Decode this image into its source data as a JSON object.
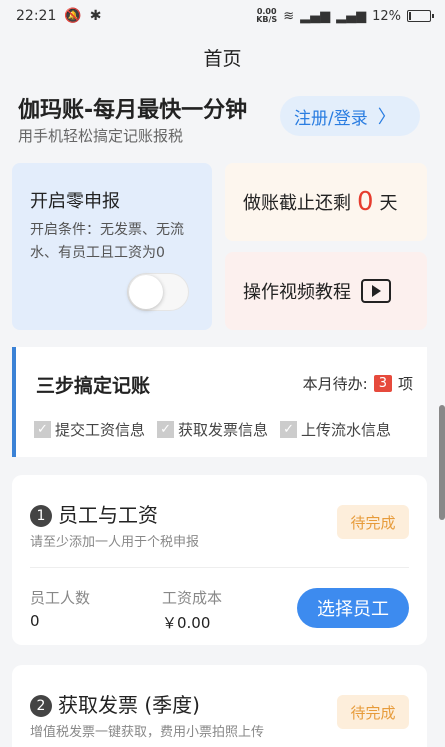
{
  "status": {
    "time": "22:21",
    "net_speed": "0.00",
    "net_unit": "KB/S",
    "battery": "12%",
    "battery_level": 0.12
  },
  "nav": {
    "title": "首页"
  },
  "brand": {
    "title": "伽玛账-每月最快一分钟",
    "subtitle": "用手机轻松搞定记账报税",
    "login_label": "注册/登录"
  },
  "zero_report": {
    "title": "开启零申报",
    "desc": "开启条件：无发票、无流水、有员工且工资为0",
    "toggle_on": false
  },
  "deadline": {
    "prefix": "做账截止还剩",
    "days": "0",
    "suffix": "天"
  },
  "video": {
    "label": "操作视频教程"
  },
  "steps": {
    "title": "三步搞定记账",
    "todo_prefix": "本月待办:",
    "todo_count": "3",
    "todo_suffix": "项",
    "items": [
      "提交工资信息",
      "获取发票信息",
      "上传流水信息"
    ]
  },
  "employees": {
    "num": "1",
    "title": "员工与工资",
    "subtitle": "请至少添加一人用于个税申报",
    "status": "待完成",
    "count_label": "员工人数",
    "count_value": "0",
    "cost_label": "工资成本",
    "cost_value": "￥0.00",
    "button": "选择员工"
  },
  "invoices": {
    "num": "2",
    "title": "获取发票 (季度)",
    "subtitle": "增值税发票一键获取，费用小票拍照上传",
    "status": "待完成"
  },
  "colors": {
    "accent": "#3d8bef",
    "alert": "#e63c2e",
    "pending": "#e79b3a"
  }
}
